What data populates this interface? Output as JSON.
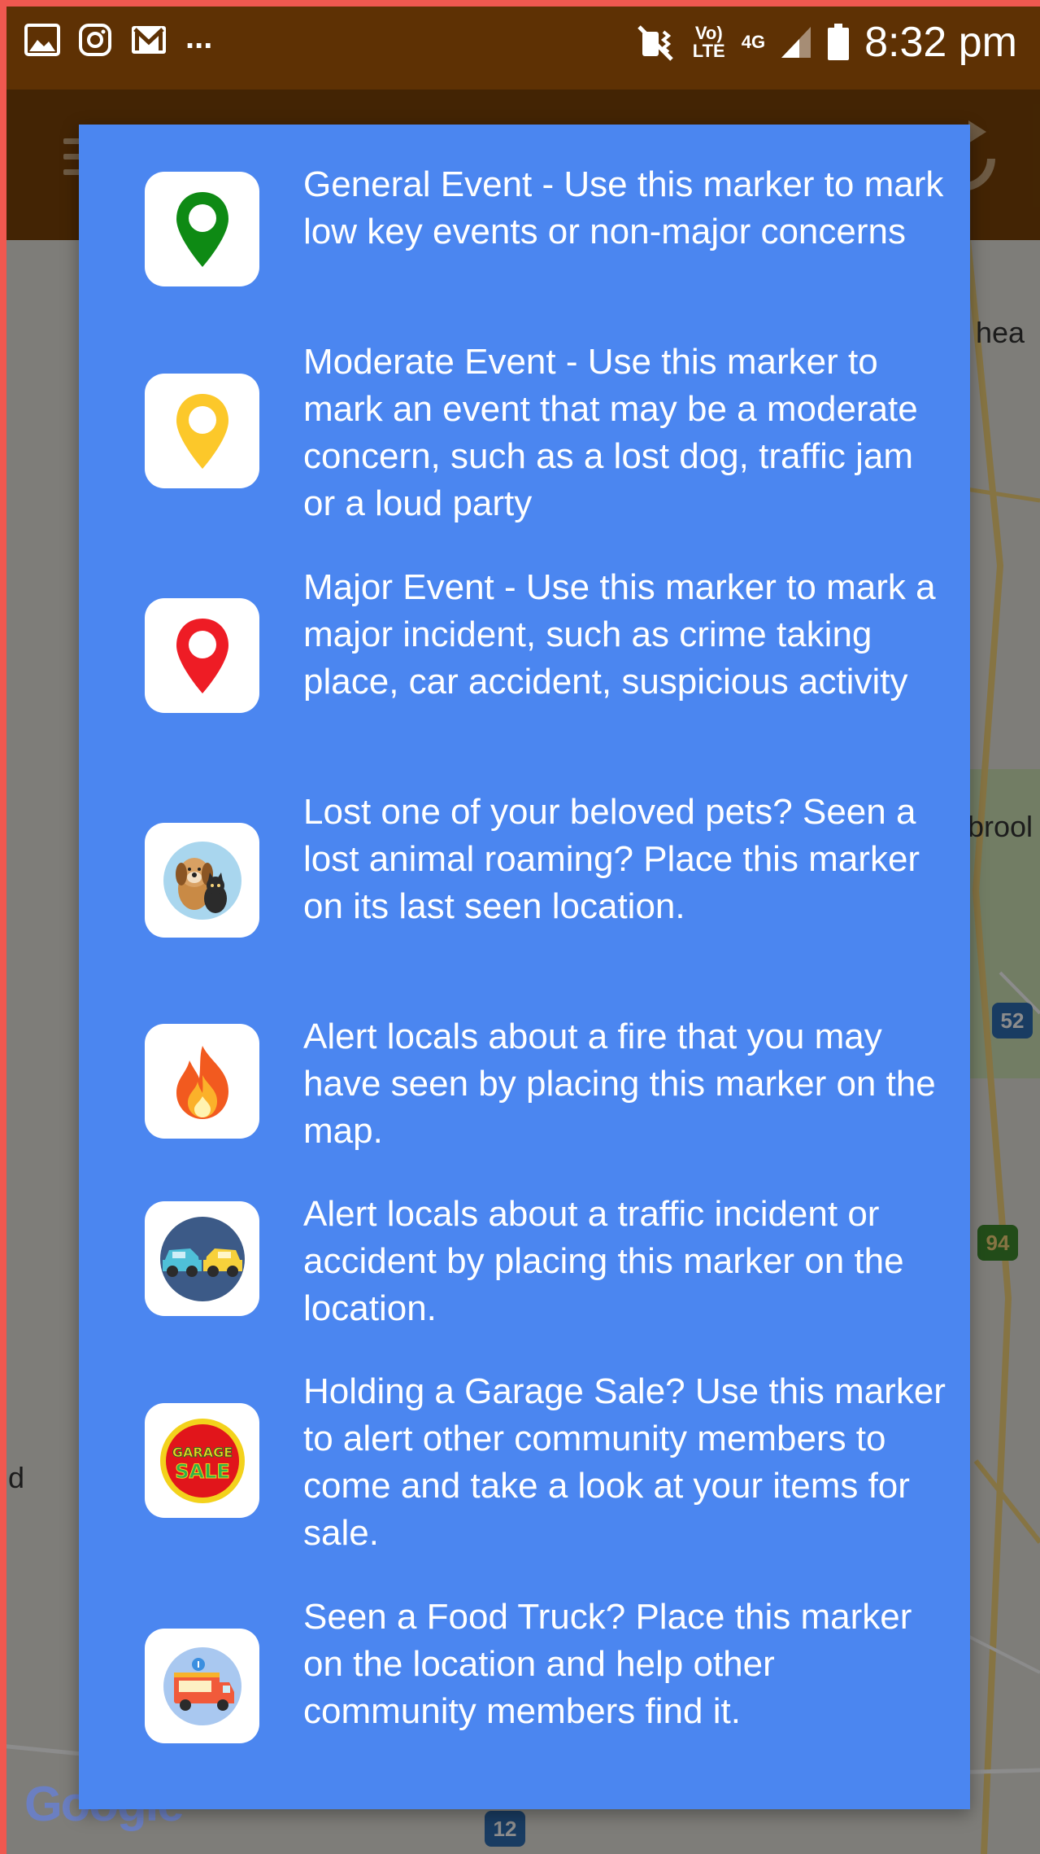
{
  "status_bar": {
    "time": "8:32 pm",
    "volte": "Vo) LTE",
    "network": "4G",
    "more": "...",
    "icons": [
      "image-icon",
      "instagram-icon",
      "gmail-icon",
      "vibrate-icon",
      "signal-icon",
      "battery-icon"
    ]
  },
  "map": {
    "labels": [
      "hea",
      "brool",
      "d"
    ],
    "shields": [
      "52",
      "94",
      "12"
    ],
    "logo": "Google"
  },
  "dialog": {
    "items": [
      {
        "icon": "green-marker-icon",
        "text": "General Event - Use this marker to mark low key events or non-major concerns"
      },
      {
        "icon": "yellow-marker-icon",
        "text": "Moderate Event - Use this marker to mark an event that may be a moderate concern, such as a lost dog, traffic jam or a loud party"
      },
      {
        "icon": "red-marker-icon",
        "text": "Major Event - Use this marker to mark a major incident, such as crime taking place, car accident, suspicious activity"
      },
      {
        "icon": "pets-icon",
        "text": "Lost one of your beloved pets? Seen a lost animal roaming? Place this marker on its last seen location."
      },
      {
        "icon": "fire-icon",
        "text": "Alert locals about a fire that you may have seen by placing this marker on the map."
      },
      {
        "icon": "traffic-accident-icon",
        "text": "Alert locals about a traffic incident or accident by placing this marker on the location."
      },
      {
        "icon": "garage-sale-icon",
        "text": "Holding a Garage Sale? Use this marker to alert other community members to come and take a look at your items for sale.",
        "icon_text": [
          "GARAGE",
          "SALE"
        ]
      },
      {
        "icon": "food-truck-icon",
        "text": "Seen a Food Truck? Place this marker on the location and help other community members find it."
      }
    ]
  },
  "colors": {
    "dialog_bg": "#4b86f0",
    "status_bar": "#5e3104",
    "app_bar": "#7a4308",
    "frame": "#f0584f"
  }
}
